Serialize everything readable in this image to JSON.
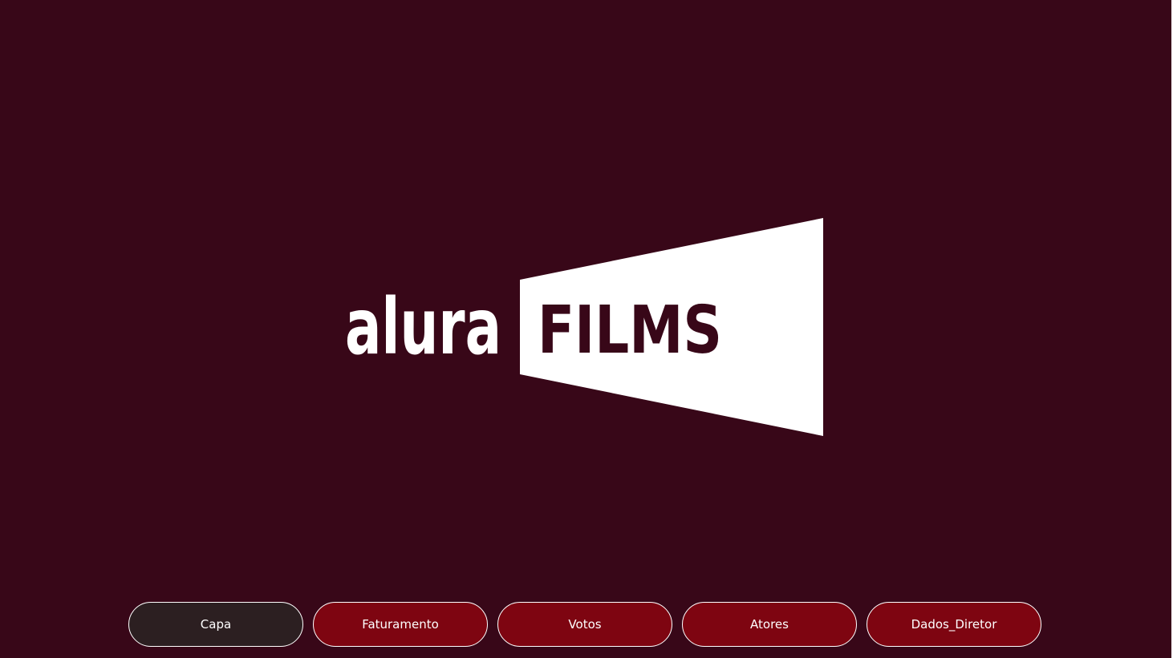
{
  "colors": {
    "background": "#380718",
    "button_default": "#7e0511",
    "button_active": "#2c1f21",
    "button_border": "#ffffff",
    "logo": "#ffffff"
  },
  "logo": {
    "word_left": "alura",
    "word_right": "FILMS",
    "icon": "projector-beam-icon"
  },
  "nav": {
    "active_index": 0,
    "buttons": [
      {
        "label": "Capa"
      },
      {
        "label": "Faturamento"
      },
      {
        "label": "Votos"
      },
      {
        "label": "Atores"
      },
      {
        "label": "Dados_Diretor"
      }
    ]
  }
}
